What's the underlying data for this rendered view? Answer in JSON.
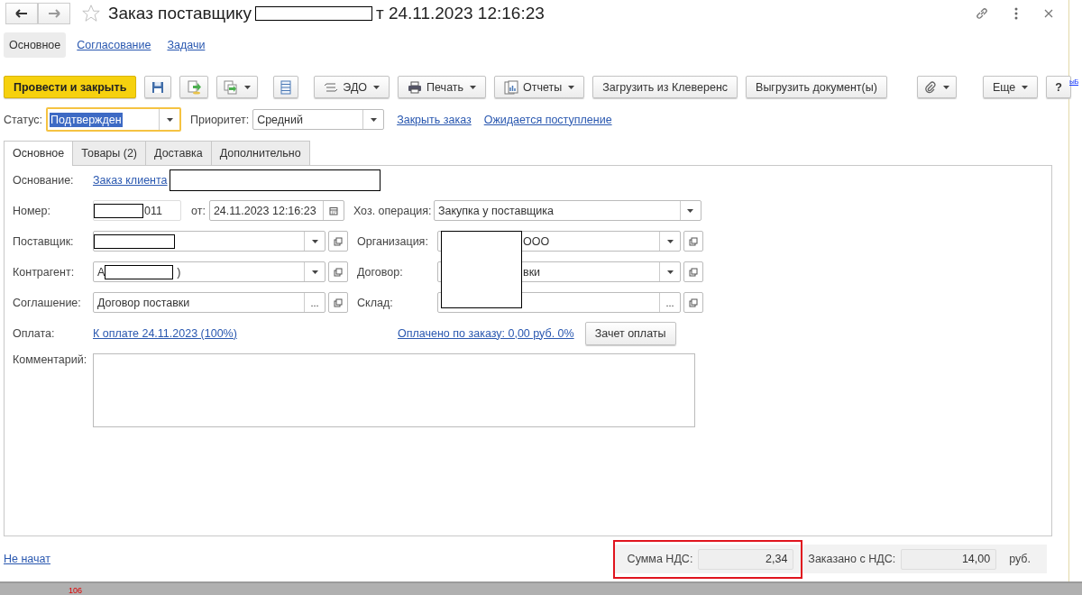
{
  "window": {
    "title_start": "Заказ поставщику",
    "title_end": "т 24.11.2023 12:16:23"
  },
  "sections": [
    {
      "label": "Основное",
      "selected": true
    },
    {
      "label": "Согласование",
      "selected": false
    },
    {
      "label": "Задачи",
      "selected": false
    }
  ],
  "toolbar": {
    "post": "Провести и закрыть",
    "edo": "ЭДО",
    "print": "Печать",
    "reports": "Отчеты",
    "load": "Загрузить из Клеверенс",
    "unload": "Выгрузить документ(ы)",
    "more": "Еще",
    "help": "?"
  },
  "status": {
    "label": "Статус:",
    "value": "Подтвержден",
    "priority_label": "Приоритет:",
    "priority": "Средний",
    "links": [
      "Закрыть заказ",
      "Ожидается поступление"
    ]
  },
  "tabs": [
    {
      "label": "Основное",
      "selected": true
    },
    {
      "label": "Товары (2)",
      "selected": false
    },
    {
      "label": "Доставка",
      "selected": false
    },
    {
      "label": "Дополнительно",
      "selected": false
    }
  ],
  "form": {
    "basis_label": "Основание:",
    "basis_link": "Заказ клиента",
    "number_label": "Номер:",
    "number": "011",
    "date_label": "от:",
    "date": "24.11.2023 12:16:23",
    "operation_label": "Хоз. операция:",
    "operation": "Закупка у поставщика",
    "rows": [
      {
        "label": "Поставщик:",
        "kind": "select",
        "right": {
          "label": "Организация:",
          "value": "ООО",
          "kind": "select"
        }
      },
      {
        "label": "Контрагент:",
        "kind": "select",
        "value_start": "А",
        "value_end": ")",
        "right": {
          "label": "Договор:",
          "value": "вки",
          "kind": "select"
        }
      },
      {
        "label": "Соглашение:",
        "kind": "choose",
        "value_start": "Договор поставки",
        "right": {
          "label": "Склад:",
          "kind": "choose"
        }
      }
    ],
    "payment_label": "Оплата:",
    "payment_link": "К оплате 24.11.2023 (100%)",
    "paid_link": "Оплачено по заказу: 0,00 руб. 0%",
    "offset_button": "Зачет оплаты",
    "comment_label": "Комментарий:",
    "choose_text": "..."
  },
  "footer": {
    "state_link": "Не начат",
    "vat_label": "Сумма НДС:",
    "vat": "2,34",
    "total_label": "Заказано с НДС:",
    "total": "14,00",
    "currency": "руб."
  },
  "side_link": "ыБ",
  "bottom_text": "106"
}
